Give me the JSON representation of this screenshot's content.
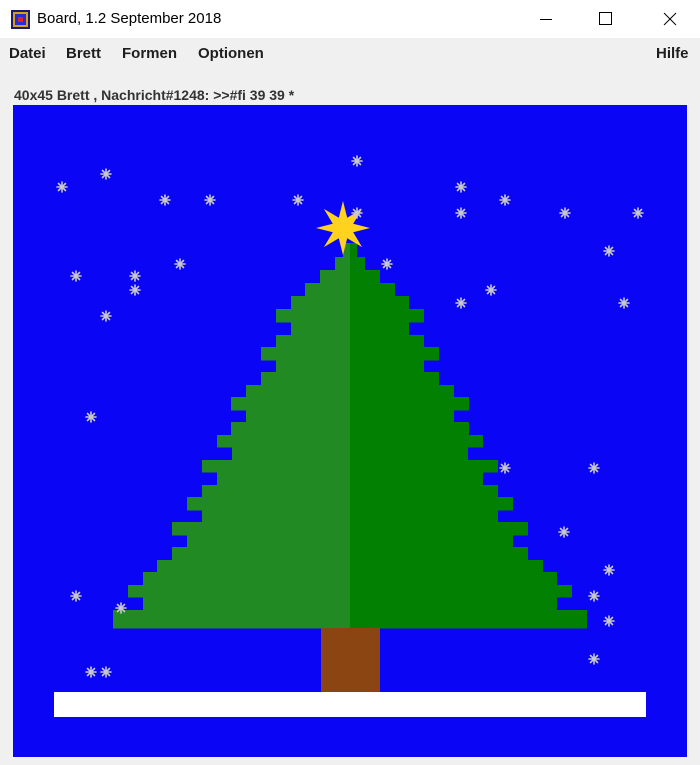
{
  "window": {
    "title": "Board, 1.2 September 2018",
    "minimize_icon": "minimize-icon",
    "maximize_icon": "maximize-icon",
    "close_icon": "close-icon"
  },
  "menu": {
    "items": [
      {
        "label": "Datei"
      },
      {
        "label": "Brett"
      },
      {
        "label": "Formen"
      },
      {
        "label": "Optionen"
      }
    ],
    "help": "Hilfe"
  },
  "status": {
    "text": "40x45 Brett , Nachricht#1248: >>#fi 39 39 *"
  },
  "board": {
    "grid_columns": 40,
    "grid_rows": 45,
    "colors": {
      "background": "#0a05f5",
      "tree_light": "#228a22",
      "tree_dark": "#028002",
      "trunk": "#8b4513",
      "ground": "#ffffff",
      "star": "#ffd21e",
      "snow": "#c8c8c8"
    },
    "icons": [
      "star-icon",
      "snowflake-icon"
    ]
  }
}
